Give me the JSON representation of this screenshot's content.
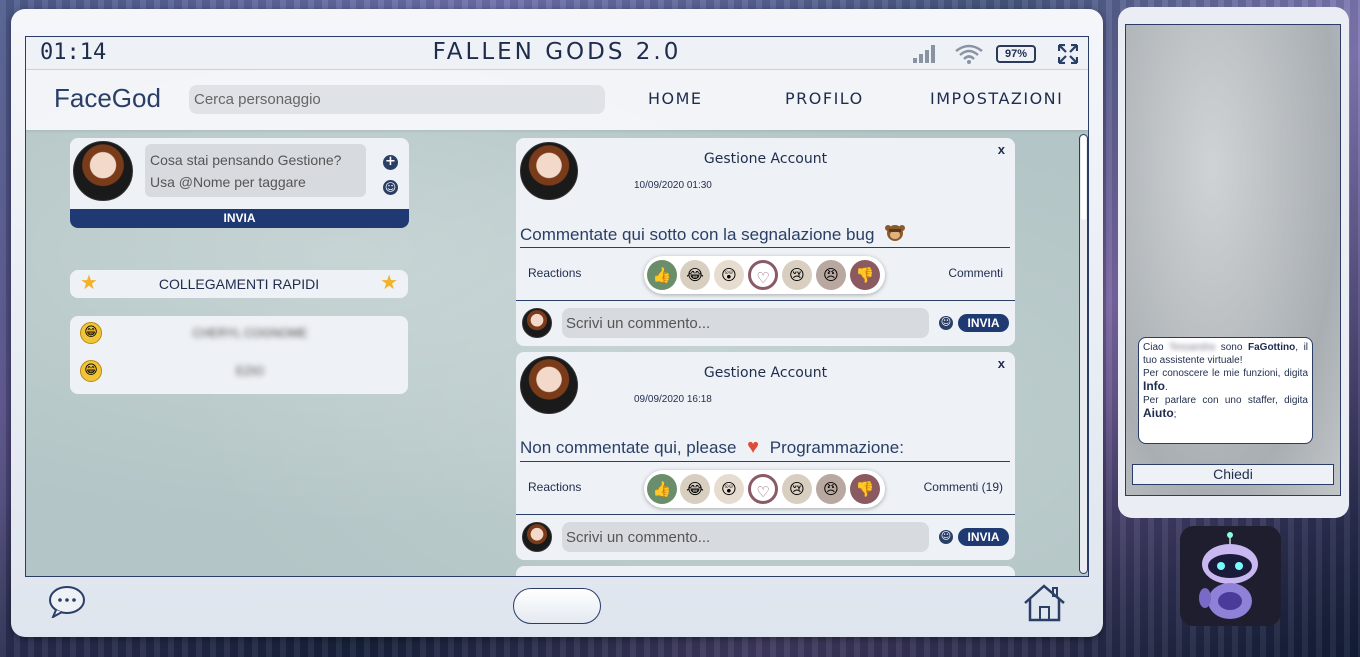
{
  "status": {
    "time": "01:14",
    "app_title": "FALLEN GODS 2.0",
    "battery": "97%"
  },
  "nav": {
    "logo": "FaceGod",
    "search_placeholder": "Cerca personaggio",
    "links": [
      "HOME",
      "PROFILO",
      "IMPOSTAZIONI"
    ]
  },
  "composer": {
    "placeholder_line1": "Cosa stai pensando Gestione?",
    "placeholder_line2": "Usa @Nome per taggare",
    "send_label": "INVIA"
  },
  "quick_links": {
    "title": "COLLEGAMENTI RAPIDI",
    "items": [
      "CHERYL COGNOME",
      "EZIO"
    ]
  },
  "posts": [
    {
      "author": "Gestione Account",
      "date": "10/09/2020 01:30",
      "close": "x",
      "body": "Commentate qui sotto con la segnalazione bug",
      "reactions_label": "Reactions",
      "comments_label": "Commenti",
      "comment_placeholder": "Scrivi un commento...",
      "send_label": "INVIA"
    },
    {
      "author": "Gestione Account",
      "date": "09/09/2020 16:18",
      "close": "x",
      "body_part1": "Non commentate qui, please",
      "body_part2": "Programmazione:",
      "reactions_label": "Reactions",
      "comments_label": "Commenti (19)",
      "comment_placeholder": "Scrivi un commento...",
      "send_label": "INVIA"
    }
  ],
  "reactions": [
    "thumbs-up",
    "laugh",
    "wow",
    "heart",
    "sad",
    "angry",
    "thumbs-down"
  ],
  "bot": {
    "greeting_prefix": "Ciao",
    "greeting_name": "Tessandra",
    "greeting_suffix": "sono",
    "bot_name": "FaGottino",
    "line1_rest": ", il tuo assistente virtuale!",
    "line2": "Per conoscere le mie funzioni, digita",
    "info_cmd": "Info",
    "line3": "Per parlare con uno staffer, digita",
    "help_cmd": "Aiuto",
    "ask_button": "Chiedi"
  },
  "colors": {
    "brand": "#1f3a73",
    "text": "#1f2d4d",
    "wall": "#b3c5c6"
  }
}
